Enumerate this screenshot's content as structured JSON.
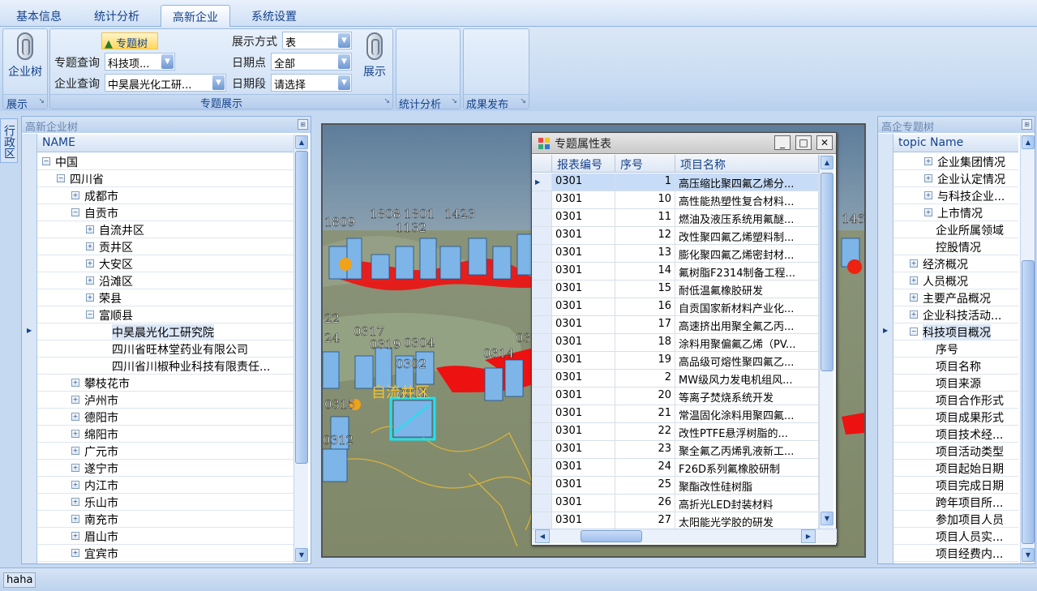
{
  "tabs": [
    "基本信息",
    "统计分析",
    "高新企业",
    "系统设置"
  ],
  "ribbon": {
    "enterprise_tree_btn": "企业树",
    "group_show": "展示",
    "topic_tree_btn": "专题树",
    "topic_query_label": "专题查询",
    "topic_query_value": "科技项...",
    "company_query_label": "企业查询",
    "company_query_value": "中昊晨光化工研...",
    "display_mode_label": "展示方式",
    "display_mode_value": "表",
    "date_point_label": "日期点",
    "date_point_value": "全部",
    "date_range_label": "日期段",
    "date_range_value": "请选择",
    "show_btn": "展示",
    "group_topic_display": "专题展示",
    "group_stats": "统计分析",
    "group_publish": "成果发布"
  },
  "side_tab": "行政区",
  "left_panel": {
    "title": "高新企业树",
    "column": "NAME",
    "rows": [
      {
        "label": "中国",
        "level": 0,
        "exp": "−"
      },
      {
        "label": "四川省",
        "level": 1,
        "exp": "−"
      },
      {
        "label": "成都市",
        "level": 2,
        "exp": "+"
      },
      {
        "label": "自贡市",
        "level": 2,
        "exp": "−"
      },
      {
        "label": "自流井区",
        "level": 3,
        "exp": "+"
      },
      {
        "label": "贡井区",
        "level": 3,
        "exp": "+"
      },
      {
        "label": "大安区",
        "level": 3,
        "exp": "+"
      },
      {
        "label": "沿滩区",
        "level": 3,
        "exp": "+"
      },
      {
        "label": "荣县",
        "level": 3,
        "exp": "+"
      },
      {
        "label": "富顺县",
        "level": 3,
        "exp": "−"
      },
      {
        "label": "中昊晨光化工研究院",
        "level": 4,
        "exp": ""
      },
      {
        "label": "四川省旺林堂药业有限公司",
        "level": 4,
        "exp": ""
      },
      {
        "label": "四川省川椒种业科技有限责任...",
        "level": 4,
        "exp": ""
      },
      {
        "label": "攀枝花市",
        "level": 2,
        "exp": "+"
      },
      {
        "label": "泸州市",
        "level": 2,
        "exp": "+"
      },
      {
        "label": "德阳市",
        "level": 2,
        "exp": "+"
      },
      {
        "label": "绵阳市",
        "level": 2,
        "exp": "+"
      },
      {
        "label": "广元市",
        "level": 2,
        "exp": "+"
      },
      {
        "label": "遂宁市",
        "level": 2,
        "exp": "+"
      },
      {
        "label": "内江市",
        "level": 2,
        "exp": "+"
      },
      {
        "label": "乐山市",
        "level": 2,
        "exp": "+"
      },
      {
        "label": "南充市",
        "level": 2,
        "exp": "+"
      },
      {
        "label": "眉山市",
        "level": 2,
        "exp": "+"
      },
      {
        "label": "宜宾市",
        "level": 2,
        "exp": "+"
      }
    ]
  },
  "right_panel": {
    "title": "高企专题树",
    "column": "topic Name",
    "rows": [
      {
        "label": "企业集团情况",
        "level": 1,
        "exp": "+"
      },
      {
        "label": "企业认定情况",
        "level": 1,
        "exp": "+"
      },
      {
        "label": "与科技企业...",
        "level": 1,
        "exp": "+"
      },
      {
        "label": "上市情况",
        "level": 1,
        "exp": "+"
      },
      {
        "label": "企业所属领域",
        "level": 1,
        "exp": ""
      },
      {
        "label": "控股情况",
        "level": 1,
        "exp": ""
      },
      {
        "label": "经济概况",
        "level": 0,
        "exp": "+"
      },
      {
        "label": "人员概况",
        "level": 0,
        "exp": "+"
      },
      {
        "label": "主要产品概况",
        "level": 0,
        "exp": "+"
      },
      {
        "label": "企业科技活动...",
        "level": 0,
        "exp": "+"
      },
      {
        "label": "科技项目概况",
        "level": 0,
        "exp": "−"
      },
      {
        "label": "序号",
        "level": 1,
        "exp": ""
      },
      {
        "label": "项目名称",
        "level": 1,
        "exp": ""
      },
      {
        "label": "项目来源",
        "level": 1,
        "exp": ""
      },
      {
        "label": "项目合作形式",
        "level": 1,
        "exp": ""
      },
      {
        "label": "项目成果形式",
        "level": 1,
        "exp": ""
      },
      {
        "label": "项目技术经...",
        "level": 1,
        "exp": ""
      },
      {
        "label": "项目活动类型",
        "level": 1,
        "exp": ""
      },
      {
        "label": "项目起始日期",
        "level": 1,
        "exp": ""
      },
      {
        "label": "项目完成日期",
        "level": 1,
        "exp": ""
      },
      {
        "label": "跨年项目所...",
        "level": 1,
        "exp": ""
      },
      {
        "label": "参加项目人员",
        "level": 1,
        "exp": ""
      },
      {
        "label": "项目人员实...",
        "level": 1,
        "exp": ""
      },
      {
        "label": "项目经费内...",
        "level": 1,
        "exp": ""
      }
    ]
  },
  "map": {
    "labels": [
      "1809",
      "1808",
      "1801",
      "1423",
      "1132",
      "0317",
      "0319",
      "0304",
      "0302",
      "0301",
      "0314",
      "0315",
      "0312",
      "22",
      "24",
      "03",
      "1463",
      "自流井区"
    ]
  },
  "dialog": {
    "title": "专题属性表",
    "minimize": "_",
    "maximize": "□",
    "close": "✕",
    "columns": [
      "报表编号",
      "序号",
      "项目名称"
    ],
    "rows": [
      [
        "0301",
        "1",
        "高压缩比聚四氟乙烯分..."
      ],
      [
        "0301",
        "10",
        "高性能热塑性复合材料..."
      ],
      [
        "0301",
        "11",
        "燃油及液压系统用氟醚..."
      ],
      [
        "0301",
        "12",
        "改性聚四氟乙烯塑料制..."
      ],
      [
        "0301",
        "13",
        "膨化聚四氟乙烯密封材..."
      ],
      [
        "0301",
        "14",
        "氟树脂F2314制备工程..."
      ],
      [
        "0301",
        "15",
        "耐低温氟橡胶研发"
      ],
      [
        "0301",
        "16",
        "自贡国家新材料产业化..."
      ],
      [
        "0301",
        "17",
        "高速挤出用聚全氟乙丙..."
      ],
      [
        "0301",
        "18",
        "涂料用聚偏氟乙烯（PV..."
      ],
      [
        "0301",
        "19",
        "高品级可熔性聚四氟乙..."
      ],
      [
        "0301",
        "2",
        "MW级风力发电机组风..."
      ],
      [
        "0301",
        "20",
        "等离子焚烧系统开发"
      ],
      [
        "0301",
        "21",
        "常温固化涂料用聚四氟..."
      ],
      [
        "0301",
        "22",
        "改性PTFE悬浮树脂的..."
      ],
      [
        "0301",
        "23",
        "聚全氟乙丙烯乳液新工..."
      ],
      [
        "0301",
        "24",
        "F26D系列氟橡胶研制"
      ],
      [
        "0301",
        "25",
        "聚酯改性硅树脂"
      ],
      [
        "0301",
        "26",
        "高折光LED封装材料"
      ],
      [
        "0301",
        "27",
        "太阳能光学胶的研发"
      ]
    ]
  },
  "status": "haha",
  "colors": {
    "accent": "#15428b",
    "selection": "#c7dcf7",
    "ribbon": "#d3e3f6"
  }
}
